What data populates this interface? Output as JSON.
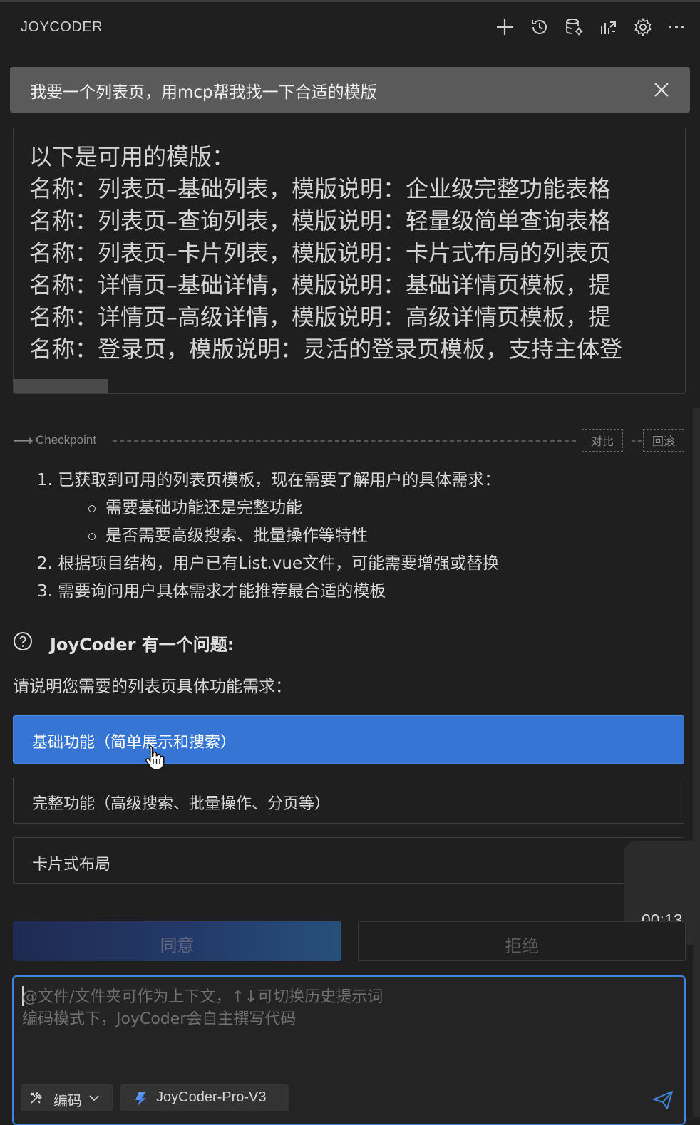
{
  "header": {
    "title": "JOYCODER",
    "icons": [
      "plus-icon",
      "history-icon",
      "database-settings-icon",
      "sync-icon",
      "gear-icon",
      "more-icon"
    ]
  },
  "task": {
    "text": "我要一个列表页，用mcp帮我找一下合适的模版"
  },
  "tool_output": {
    "lines": [
      "以下是可用的模版：",
      "名称：列表页–基础列表，模版说明：企业级完整功能表格",
      "名称：列表页–查询列表，模版说明：轻量级简单查询表格",
      "名称：列表页–卡片列表，模版说明：卡片式布局的列表页",
      "名称：详情页–基础详情，模版说明：基础详情页模板，提",
      "名称：详情页–高级详情，模版说明：高级详情页模板，提",
      "名称：登录页，模版说明：灵活的登录页模板，支持主体登"
    ]
  },
  "checkpoint": {
    "label": "Checkpoint",
    "compare": "对比",
    "rollback": "回滚"
  },
  "reasoning": {
    "item1": "1. 已获取到可用的列表页模板，现在需要了解用户的具体需求：",
    "sub1": "需要基础功能还是完整功能",
    "sub2": "是否需要高级搜索、批量操作等特性",
    "item2": "2. 根据项目结构，用户已有List.vue文件，可能需要增强或替换",
    "item3": "3. 需要询问用户具体需求才能推荐最合适的模板"
  },
  "question": {
    "title": "JoyCoder 有一个问题:",
    "prompt": "请说明您需要的列表页具体功能需求：",
    "options": [
      {
        "label": "基础功能（简单展示和搜索）",
        "selected": true
      },
      {
        "label": "完整功能（高级搜索、批量操作、分页等）",
        "selected": false
      },
      {
        "label": "卡片式布局",
        "selected": false
      }
    ]
  },
  "timer": {
    "value": "00:13"
  },
  "actions": {
    "agree": "同意",
    "reject": "拒绝"
  },
  "composer": {
    "placeholder_line1": "@文件/文件夹可作为上下文，↑↓可切换历史提示词",
    "placeholder_line2": "编码模式下，JoyCoder会自主撰写代码",
    "mode": "编码",
    "model": "JoyCoder-Pro-V3"
  },
  "colors": {
    "background": "#1f1f1f",
    "accent": "#3675d4",
    "input_border": "#3f86dc",
    "banner": "#5a5a5a"
  }
}
